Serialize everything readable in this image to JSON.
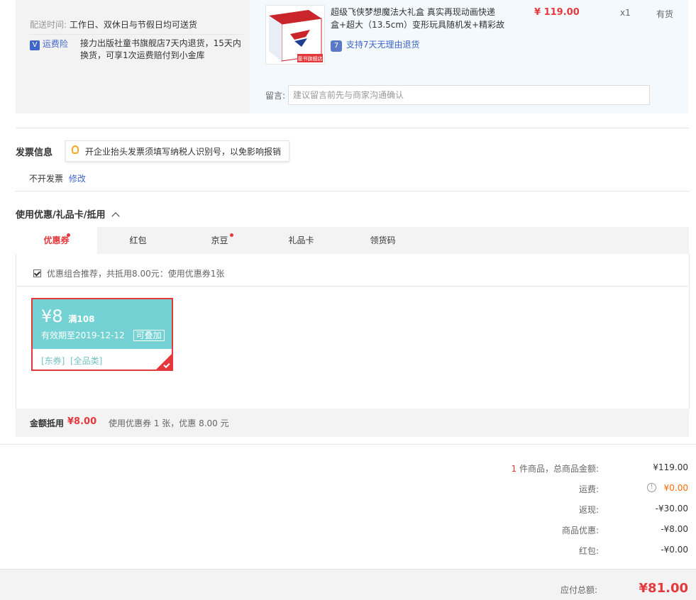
{
  "delivery": {
    "time_label": "配送时间:",
    "time_value": "工作日、双休日与节假日均可送货",
    "insurance_icon": "shield-v-icon",
    "insurance_label": "运费险",
    "insurance_desc_line1": "接力出版社童书旗舰店7天内退货，15天内",
    "insurance_desc_line2": "换货，可享1次运费赔付到小金库"
  },
  "product": {
    "image_banner": "童书旗舰店",
    "title_line1": "超级飞侠梦想魔法大礼盒 真实再现动画快递",
    "title_line2": "盒+超大（13.5cm）变形玩具随机发+精彩故",
    "price": "¥ 119.00",
    "quantity": "x1",
    "stock": "有货",
    "return_badge": "7",
    "return_text": "支持7天无理由退货",
    "remark_label": "留言:",
    "remark_placeholder": "建议留言前先与商家沟通确认"
  },
  "invoice": {
    "title": "发票信息",
    "tip": "开企业抬头发票须填写纳税人识别号，以免影响报销",
    "value": "不开发票",
    "edit_link": "修改"
  },
  "discount": {
    "title": "使用优惠/礼品卡/抵用",
    "tabs": [
      {
        "label": "优惠券"
      },
      {
        "label": "红包"
      },
      {
        "label": "京豆"
      },
      {
        "label": "礼品卡"
      },
      {
        "label": "领货码"
      }
    ],
    "recommend_text": "优惠组合推荐，共抵用8.00元：使用优惠券1张",
    "coupon": {
      "amount": "¥8",
      "condition": "满108",
      "expiry": "有效期至2019-12-12",
      "stack_label": "可叠加",
      "tags": "[东券]  [全品类]"
    },
    "summary_label": "金额抵用",
    "summary_amount": "¥8.00",
    "summary_detail": "使用优惠券 1 张，优惠 8.00 元"
  },
  "totals": {
    "count": "1",
    "count_suffix": " 件商品，总商品金额:",
    "goods_total": "¥119.00",
    "shipping_label": "运费:",
    "shipping_value": "¥0.00",
    "rebate_label": "返现:",
    "rebate_value": "-¥30.00",
    "goods_discount_label": "商品优惠:",
    "goods_discount_value": "-¥8.00",
    "redpacket_label": "红包:",
    "redpacket_value": "-¥0.00",
    "payable_label": "应付总额:",
    "payable_value": "¥81.00"
  },
  "colors": {
    "accent": "#e4393c",
    "coupon_bg": "#74d2d4",
    "link": "#3f66c9"
  }
}
